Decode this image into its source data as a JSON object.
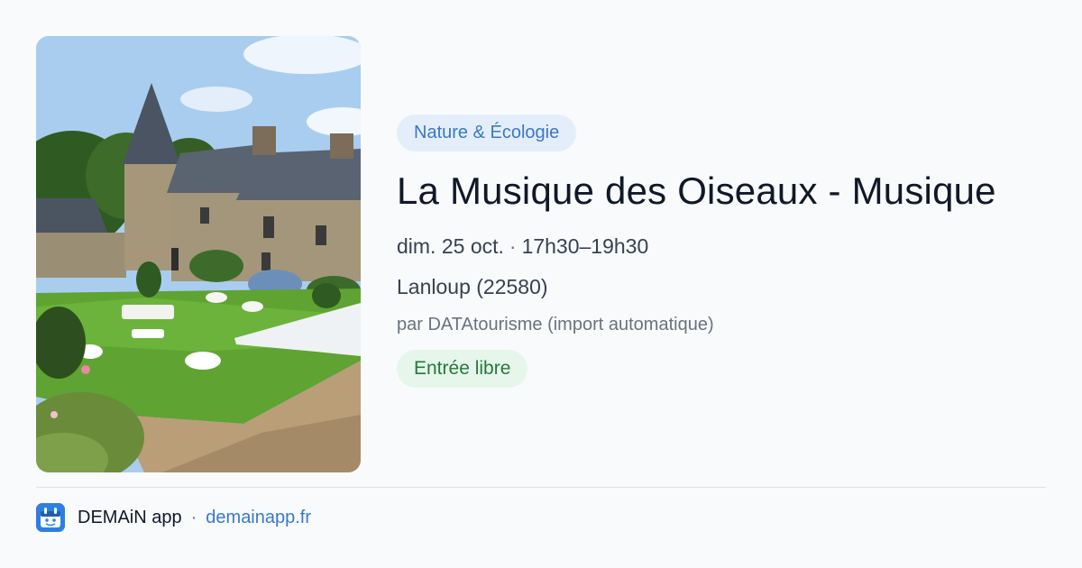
{
  "event": {
    "category": "Nature & Écologie",
    "title": "La Musique des Oiseaux - Musique",
    "date": "dim. 25 oct.",
    "separator": "·",
    "time": "17h30–19h30",
    "location": "Lanloup (22580)",
    "organizer": "par DATAtourisme (import automatique)",
    "price": "Entrée libre",
    "image_icon": "chateau-garden-photo"
  },
  "footer": {
    "app_name": "DEMAiN app",
    "separator": "·",
    "url": "demainapp.fr",
    "logo_icon": "demain-app-logo-icon"
  },
  "colors": {
    "background": "#f8fafc",
    "category_bg": "#e4eefb",
    "category_text": "#3a78c9",
    "price_bg": "#e6f6ea",
    "price_text": "#237a3b",
    "link": "#3a78c9",
    "logo_bg": "#2e7fe0"
  }
}
